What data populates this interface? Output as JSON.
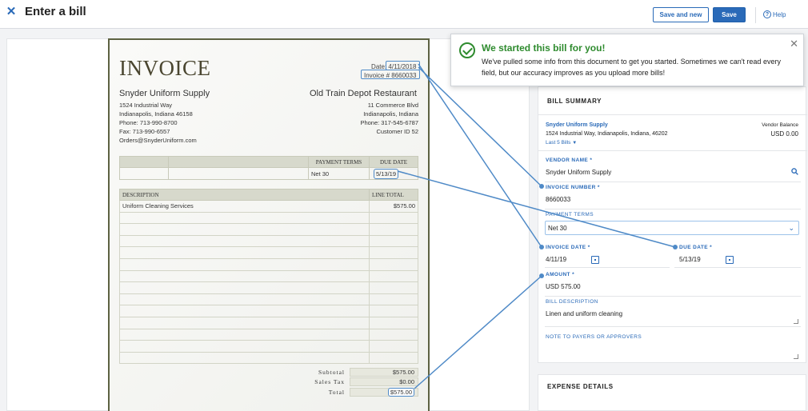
{
  "header": {
    "close_glyph": "✕",
    "title": "Enter a bill",
    "save_new_label": "Save and new",
    "save_label": "Save",
    "help_label": "Help",
    "help_glyph": "?"
  },
  "invoice": {
    "title": "INVOICE",
    "date_line": "Date: 4/11/2018",
    "number_line": "Invoice # 8660033",
    "vendor": {
      "name": "Snyder Uniform Supply",
      "lines": [
        "1524 Industrial Way",
        "Indianapolis, Indiana 46158",
        "Phone: 713-990-8700",
        "Fax: 713-990-6557",
        "Orders@SnyderUniform.com"
      ]
    },
    "customer": {
      "name": "Old Train Depot Restaurant",
      "lines": [
        "11 Commerce Blvd",
        "Indianapolis, Indiana",
        "Phone: 317-545-6787",
        "Customer ID 52"
      ]
    },
    "terms_headers": [
      "",
      "",
      "PAYMENT TERMS",
      "DUE DATE"
    ],
    "terms_row": [
      "",
      "",
      "Net 30",
      "5/13/19"
    ],
    "lines_headers": [
      "DESCRIPTION",
      "LINE TOTAL"
    ],
    "lines": [
      {
        "desc": "Uniform Cleaning Services",
        "amount": "$575.00"
      }
    ],
    "totals": [
      {
        "label": "Subtotal",
        "value": "$575.00"
      },
      {
        "label": "Sales Tax",
        "value": "$0.00"
      },
      {
        "label": "Total",
        "value": "$575.00"
      }
    ]
  },
  "toast": {
    "title": "We started this bill for you!",
    "message": "We've pulled some info from this document to get you started. Sometimes we can't read every field, but our accuracy improves as you upload more bills!",
    "close_glyph": "✕"
  },
  "summary": {
    "title": "BILL SUMMARY",
    "vendor_name": "Snyder Uniform Supply",
    "vendor_address": "1524 Industrial Way, Indianapolis, Indiana, 46202",
    "last_bills": "Last 5 Bills",
    "vendor_balance_label": "Vendor Balance",
    "vendor_balance_value": "USD 0.00",
    "fields": {
      "vendor_name_label": "VENDOR NAME *",
      "vendor_name_value": "Snyder Uniform Supply",
      "invoice_number_label": "INVOICE NUMBER *",
      "invoice_number_value": "8660033",
      "payment_terms_label": "PAYMENT TERMS",
      "payment_terms_value": "Net 30",
      "invoice_date_label": "INVOICE DATE *",
      "invoice_date_value": "4/11/19",
      "due_date_label": "DUE DATE *",
      "due_date_value": "5/13/19",
      "amount_label": "AMOUNT *",
      "amount_value": "USD 575.00",
      "bill_description_label": "BILL DESCRIPTION",
      "bill_description_value": "Linen and uniform cleaning",
      "note_label": "NOTE TO PAYERS OR APPROVERS"
    }
  },
  "expense": {
    "title": "EXPENSE DETAILS"
  },
  "colors": {
    "accent": "#2a6ab8",
    "success": "#2e8b2e",
    "connector": "#4f8ac7"
  }
}
